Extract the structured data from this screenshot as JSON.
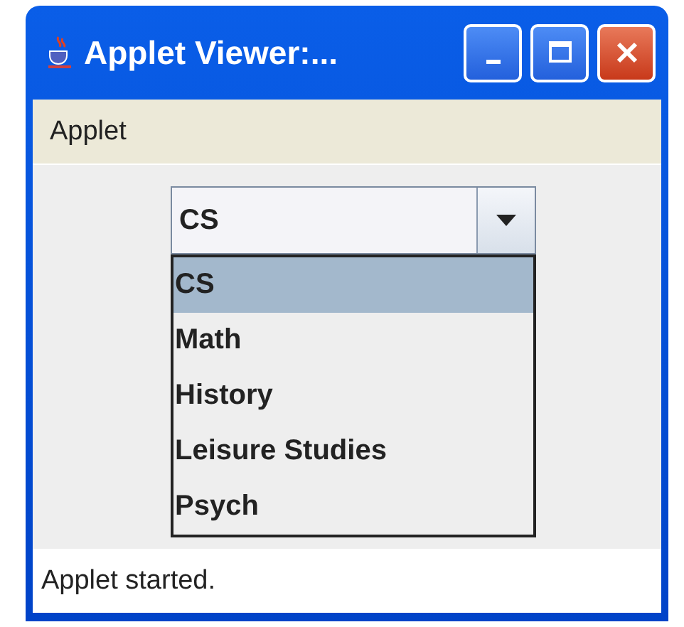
{
  "window": {
    "title": "Applet Viewer:..."
  },
  "menu_bar": {
    "items": [
      "Applet"
    ]
  },
  "combo_box": {
    "value": "CS",
    "expanded": true,
    "options": [
      {
        "label": "CS",
        "selected": true
      },
      {
        "label": "Math",
        "selected": false
      },
      {
        "label": "History",
        "selected": false
      },
      {
        "label": "Leisure Studies",
        "selected": false
      },
      {
        "label": "Psych",
        "selected": false
      }
    ]
  },
  "status_bar": "Applet started."
}
